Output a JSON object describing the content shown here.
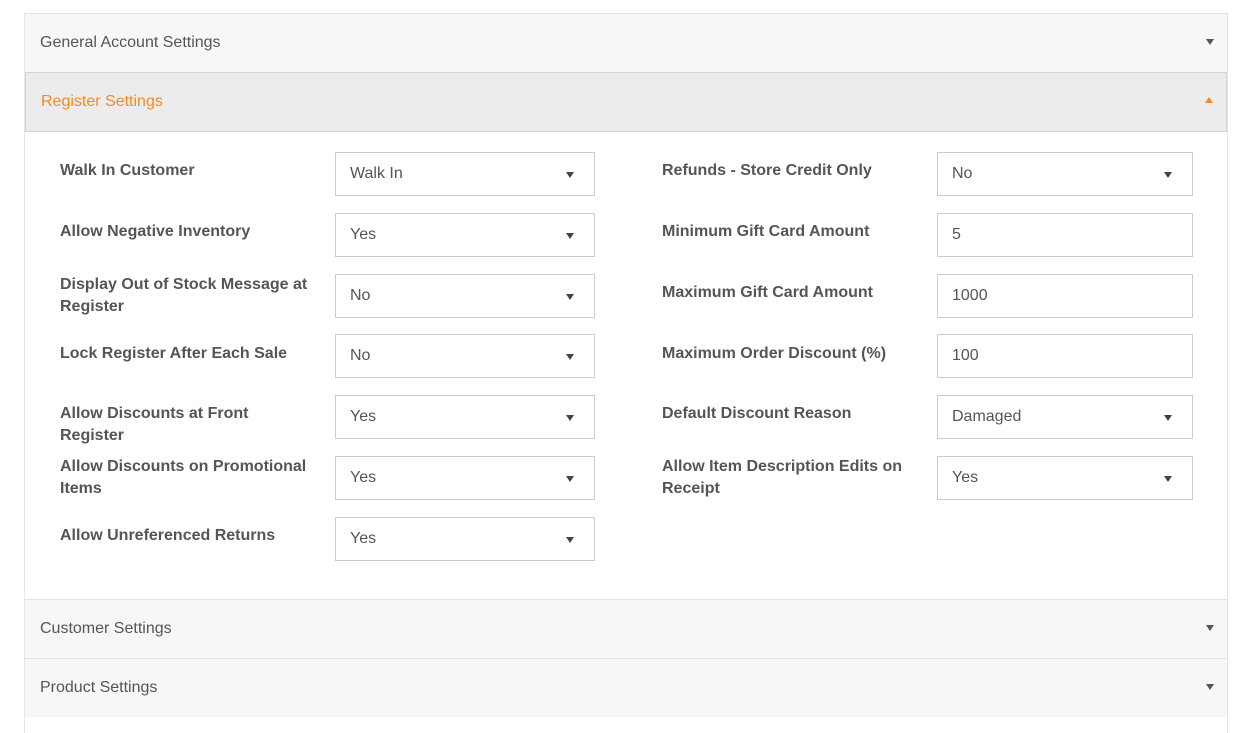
{
  "sections": {
    "general": {
      "title": "General Account Settings"
    },
    "register": {
      "title": "Register Settings"
    },
    "customer": {
      "title": "Customer Settings"
    },
    "product": {
      "title": "Product Settings"
    }
  },
  "register_left": [
    {
      "label": "Walk In Customer",
      "value": "Walk In",
      "type": "select"
    },
    {
      "label": "Allow Negative Inventory",
      "value": "Yes",
      "type": "select"
    },
    {
      "label": "Display Out of Stock Message at Register",
      "value": "No",
      "type": "select"
    },
    {
      "label": "Lock Register After Each Sale",
      "value": "No",
      "type": "select"
    },
    {
      "label": "Allow Discounts at Front Register",
      "value": "Yes",
      "type": "select"
    },
    {
      "label": "Allow Discounts on Promotional Items",
      "value": "Yes",
      "type": "select"
    },
    {
      "label": "Allow Unreferenced Returns",
      "value": "Yes",
      "type": "select"
    }
  ],
  "register_right": [
    {
      "label": "Refunds - Store Credit Only",
      "value": "No",
      "type": "select"
    },
    {
      "label": "Minimum Gift Card Amount",
      "value": "5",
      "type": "text"
    },
    {
      "label": "Maximum Gift Card Amount",
      "value": "1000",
      "type": "text"
    },
    {
      "label": "Maximum Order Discount (%)",
      "value": "100",
      "type": "text"
    },
    {
      "label": "Default Discount Reason",
      "value": "Damaged",
      "type": "select"
    },
    {
      "label": "Allow Item Description Edits on Receipt",
      "value": "Yes",
      "type": "select"
    }
  ],
  "colors": {
    "accent": "#f58a24",
    "text": "#555555",
    "header_bg": "#f7f7f7",
    "active_header_bg": "#ececec",
    "border": "#cccccc"
  },
  "icons": {
    "collapsed": "chevron-down-icon",
    "expanded": "chevron-up-icon",
    "select": "dropdown-arrow-icon"
  }
}
